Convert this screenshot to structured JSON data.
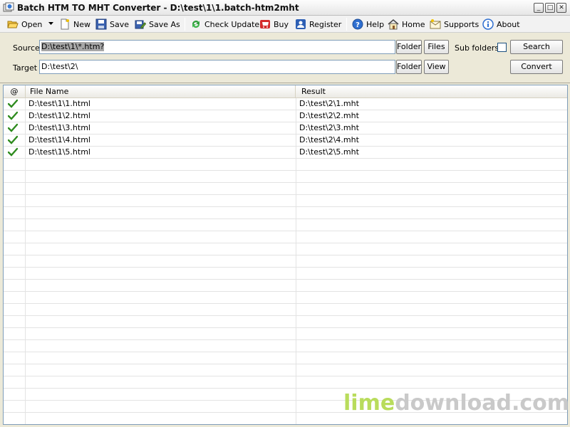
{
  "window": {
    "title": "Batch HTM TO MHT Converter - D:\\test\\1\\1.batch-htm2mht",
    "minimize": "_",
    "maximize": "□",
    "close": "✕"
  },
  "toolbar": {
    "open": "Open",
    "new": "New",
    "save": "Save",
    "save_as": "Save As",
    "check_update": "Check Update",
    "buy": "Buy",
    "register": "Register",
    "help": "Help",
    "home": "Home",
    "supports": "Supports",
    "about": "About"
  },
  "source": {
    "label": "Source",
    "value": "D:\\test\\1\\*.htm?",
    "folder_button": "Folder",
    "files_button": "Files",
    "subfolders_label": "Sub folders",
    "subfolders_checked": false,
    "search_button": "Search"
  },
  "target": {
    "label": "Target",
    "value": "D:\\test\\2\\",
    "folder_button": "Folder",
    "view_button": "View",
    "convert_button": "Convert"
  },
  "grid": {
    "columns": {
      "status": "@",
      "file_name": "File Name",
      "result": "Result"
    },
    "rows": [
      {
        "status": "done",
        "file": "D:\\test\\1\\1.html",
        "result": "D:\\test\\2\\1.mht"
      },
      {
        "status": "done",
        "file": "D:\\test\\1\\2.html",
        "result": "D:\\test\\2\\2.mht"
      },
      {
        "status": "done",
        "file": "D:\\test\\1\\3.html",
        "result": "D:\\test\\2\\3.mht"
      },
      {
        "status": "done",
        "file": "D:\\test\\1\\4.html",
        "result": "D:\\test\\2\\4.mht"
      },
      {
        "status": "done",
        "file": "D:\\test\\1\\5.html",
        "result": "D:\\test\\2\\5.mht"
      }
    ]
  },
  "watermark": {
    "part1": "lime",
    "part2": "download.com"
  },
  "colors": {
    "check_green": "#2e8b1e",
    "watermark_lime": "#b9dc5c",
    "watermark_gray": "#c9c9c9"
  }
}
